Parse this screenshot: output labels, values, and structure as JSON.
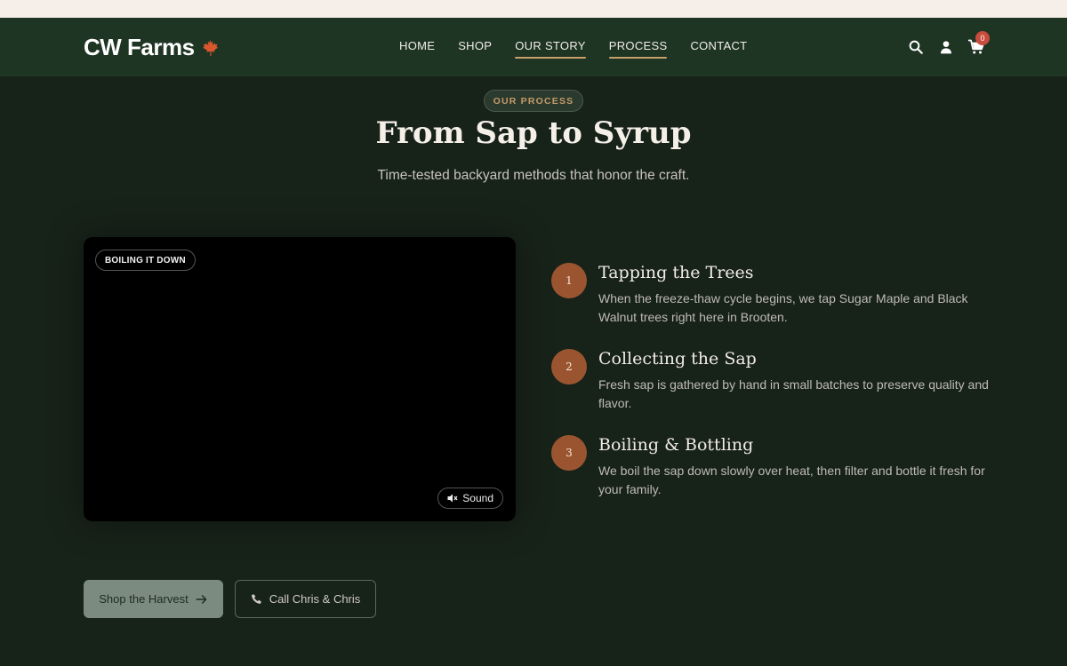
{
  "brand": {
    "name": "CW Farms",
    "icon": "maple-leaf-icon",
    "leaf_color": "#d9562e"
  },
  "nav": [
    {
      "label": "HOME",
      "active": false
    },
    {
      "label": "SHOP",
      "active": false
    },
    {
      "label": "OUR STORY",
      "active": true
    },
    {
      "label": "PROCESS",
      "active": true
    },
    {
      "label": "CONTACT",
      "active": false
    }
  ],
  "header_icons": [
    "search-icon",
    "user-icon",
    "cart-icon"
  ],
  "cart": {
    "count": "0"
  },
  "hero": {
    "eyebrow": "OUR PROCESS",
    "title": "From Sap to Syrup",
    "subtitle": "Time-tested backyard methods that honor the craft."
  },
  "video": {
    "tag": "BOILING IT DOWN",
    "sound_label": "Sound",
    "sound_icon": "speaker-muted-icon"
  },
  "steps": [
    {
      "num": "1",
      "title": "Tapping the Trees",
      "desc": "When the freeze-thaw cycle begins, we tap Sugar Maple and Black Walnut trees right here in Brooten."
    },
    {
      "num": "2",
      "title": "Collecting the Sap",
      "desc": "Fresh sap is gathered by hand in small batches to preserve quality and flavor."
    },
    {
      "num": "3",
      "title": "Boiling & Bottling",
      "desc": "We boil the sap down slowly over heat, then filter and bottle it fresh for your family."
    }
  ],
  "cta": {
    "primary": "Shop the Harvest",
    "primary_icon": "arrow-right-icon",
    "secondary": "Call Chris & Chris",
    "secondary_icon": "phone-icon"
  },
  "colors": {
    "accent": "#9a5530",
    "header_bg": "#1f3524",
    "page_bg": "#172219",
    "underline": "#c7a06a"
  }
}
